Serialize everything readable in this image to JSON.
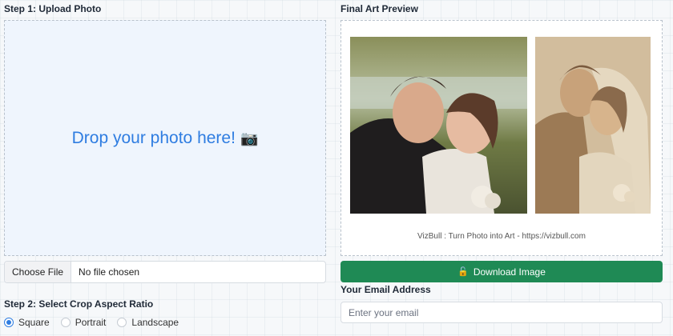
{
  "step1": {
    "heading": "Step 1: Upload Photo"
  },
  "dropzone": {
    "text": "Drop your photo here!",
    "icon": "camera-icon",
    "text_color": "#2f7de1"
  },
  "file_input": {
    "button_label": "Choose File",
    "status": "No file chosen"
  },
  "step2": {
    "heading": "Step 2: Select Crop Aspect Ratio",
    "options": [
      {
        "label": "Square",
        "checked": true
      },
      {
        "label": "Portrait",
        "checked": false
      },
      {
        "label": "Landscape",
        "checked": false
      }
    ]
  },
  "preview": {
    "heading": "Final Art Preview",
    "caption": "VizBull : Turn Photo into Art - https://vizbull.com"
  },
  "download": {
    "label": "Download Image",
    "icon": "unlock-icon",
    "color": "#1f8a55"
  },
  "email": {
    "heading": "Your Email Address",
    "placeholder": "Enter your email"
  }
}
